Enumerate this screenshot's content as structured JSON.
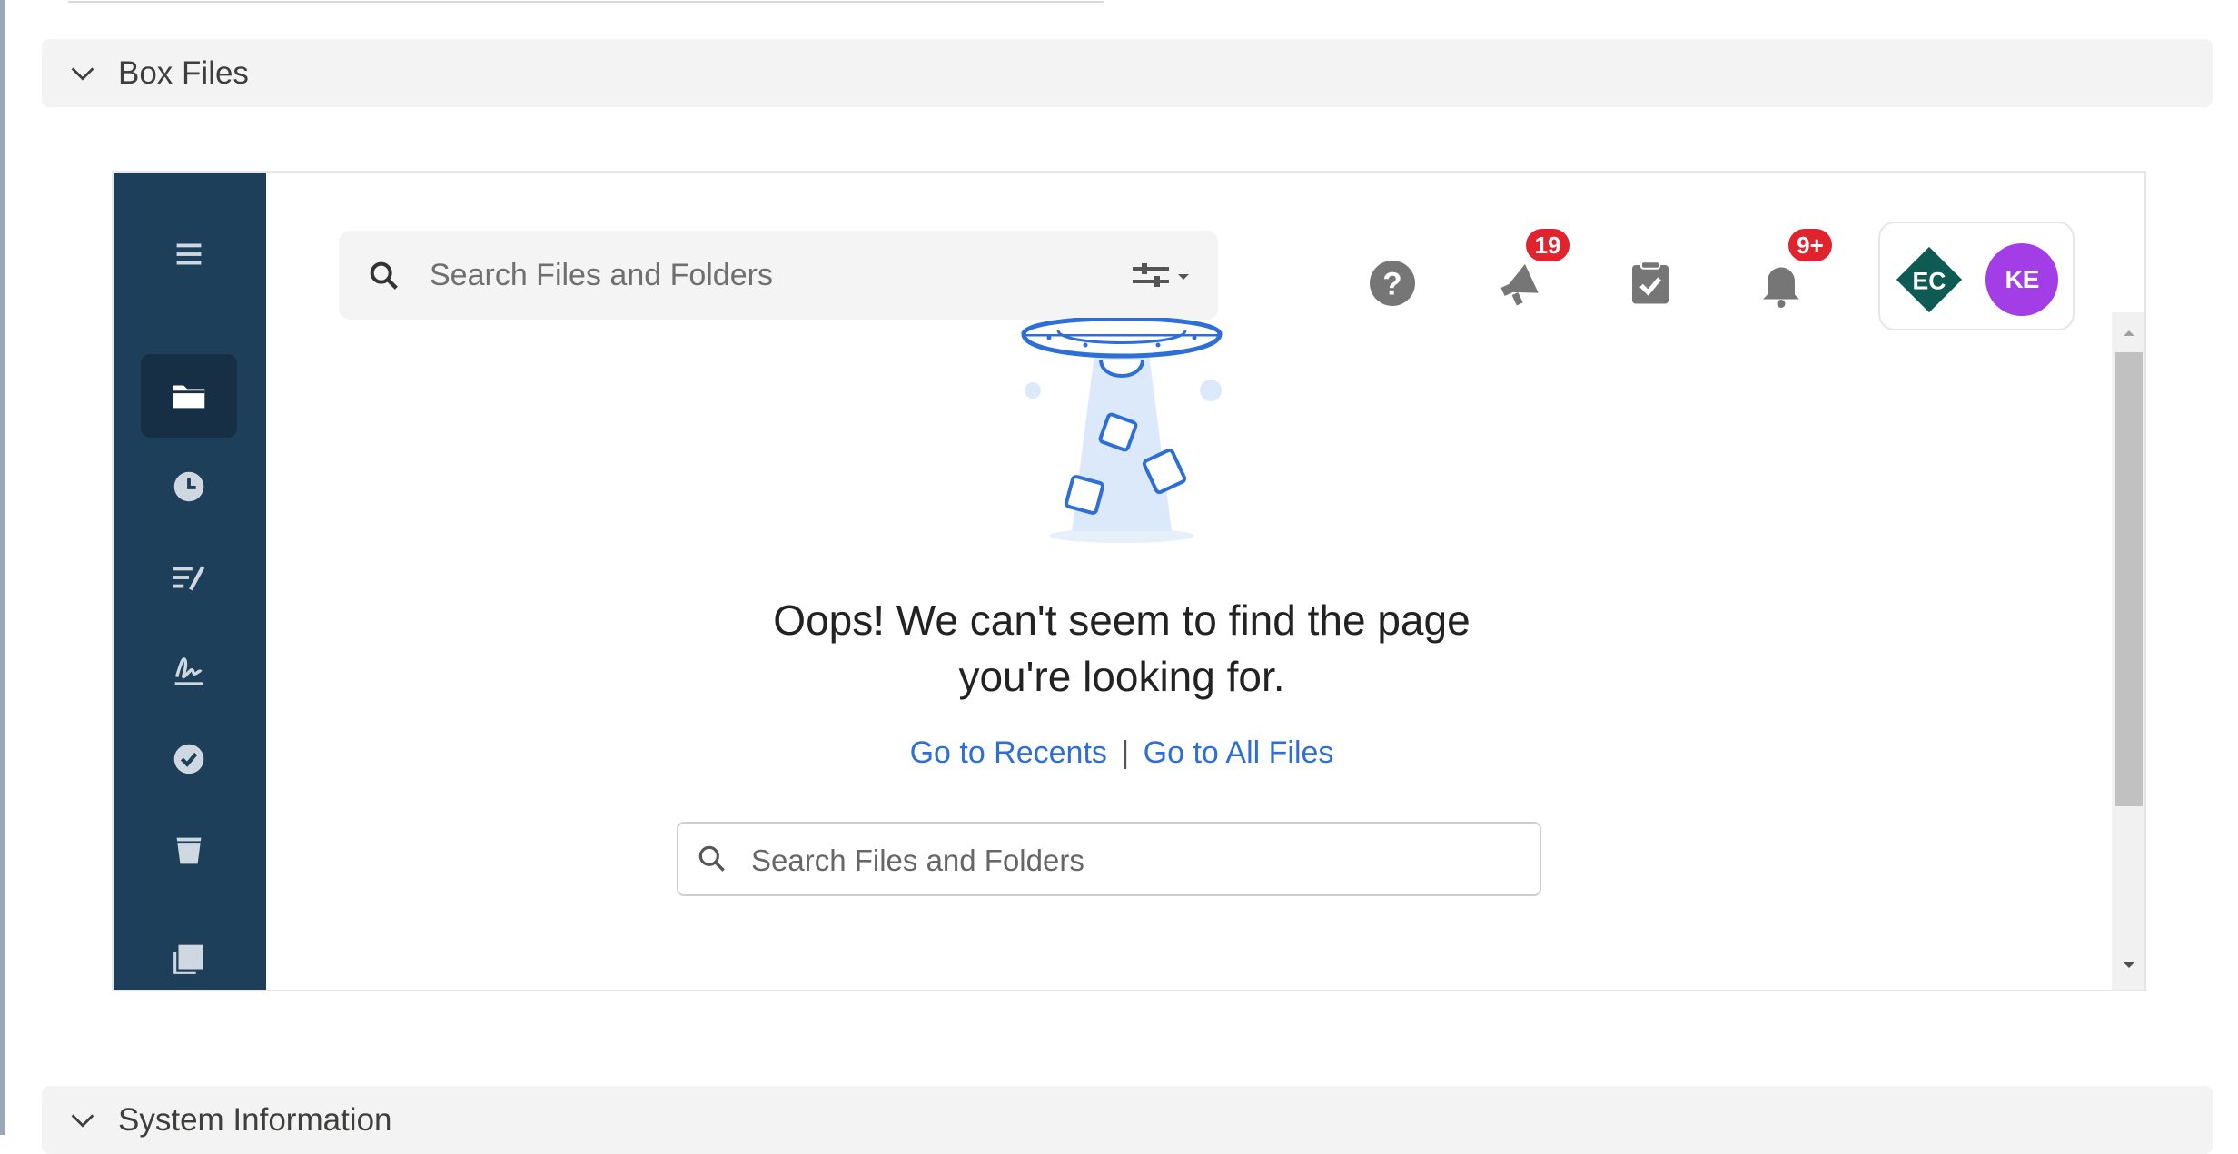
{
  "sections": {
    "box_files": {
      "title": "Box Files"
    },
    "system_information": {
      "title": "System Information"
    }
  },
  "box": {
    "sidebar": {
      "items": [
        {
          "icon": "hamburger-menu-icon"
        },
        {
          "icon": "folder-icon",
          "active": true
        },
        {
          "icon": "clock-icon"
        },
        {
          "icon": "notes-icon"
        },
        {
          "icon": "signature-icon"
        },
        {
          "icon": "check-circle-icon"
        },
        {
          "icon": "trash-icon"
        },
        {
          "icon": "copy-icon"
        }
      ]
    },
    "search": {
      "placeholder": "Search Files and Folders"
    },
    "header": {
      "announcements_badge": "19",
      "notifications_badge": "9+",
      "avatars": {
        "ec": "EC",
        "ke": "KE"
      }
    },
    "empty_state": {
      "message_line1": "Oops! We can't seem to find the page",
      "message_line2": "you're looking for.",
      "link_recents": "Go to Recents",
      "separator": "|",
      "link_all_files": "Go to All Files",
      "search_placeholder": "Search Files and Folders"
    }
  },
  "colors": {
    "sidebar_bg": "#1e3f5a",
    "badge_red": "#e0242e",
    "link_blue": "#2d6fd6",
    "avatar_ke": "#a33ee6",
    "avatar_ec": "#0d5b52"
  }
}
